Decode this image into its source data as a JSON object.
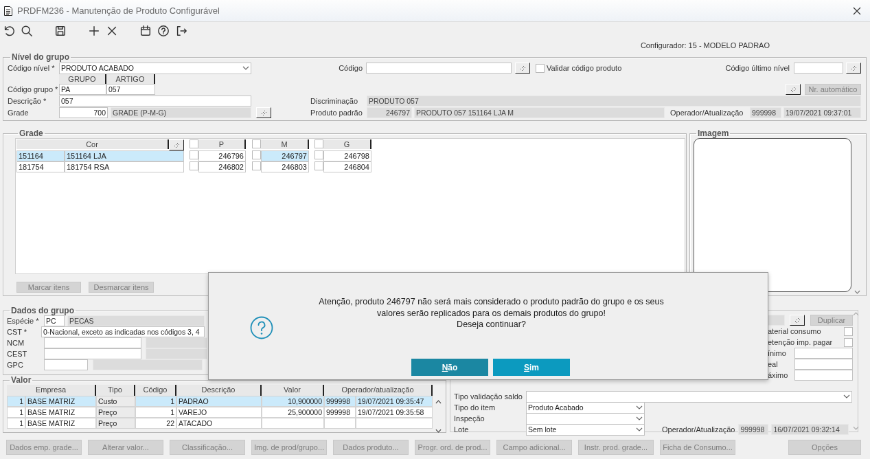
{
  "window": {
    "title": "PRDFM236 - Manutenção de Produto Configurável"
  },
  "configurator": "Configurador: 15 - MODELO PADRAO",
  "group_level": {
    "legend": "Nível do grupo",
    "codigo_nivel": {
      "label": "Código nível *",
      "value": "PRODUTO ACABADO"
    },
    "codigo": {
      "label": "Código"
    },
    "validar": {
      "label": "Validar código produto",
      "checked": false
    },
    "codigo_ultimo_nivel": {
      "label": "Código último nível"
    },
    "group_headers": [
      "GRUPO",
      "ARTIGO"
    ],
    "codigo_grupo": {
      "label": "Código grupo *",
      "values": [
        "PA",
        "057"
      ]
    },
    "nr_automatico": {
      "label": "Nr. automático",
      "disabled": true
    },
    "descricao": {
      "label": "Descrição *",
      "value": "057"
    },
    "discriminacao": {
      "label": "Discriminação",
      "value": "PRODUTO 057"
    },
    "grade": {
      "label": "Grade",
      "code": "700",
      "name": "GRADE (P-M-G)"
    },
    "produto_padrao": {
      "label": "Produto padrão",
      "code": "246797",
      "name": "PRODUTO 057 151164 LJA M"
    },
    "operador": {
      "label": "Operador/Atualização",
      "user": "999998",
      "date": "19/07/2021 09:37:01"
    }
  },
  "grade": {
    "legend": "Grade",
    "color_header": "Cor",
    "sizes": [
      {
        "label": "P",
        "checked": false
      },
      {
        "label": "M",
        "checked": false
      },
      {
        "label": "G",
        "checked": false
      }
    ],
    "rows": [
      {
        "code": "151164",
        "name": "151164 LJA",
        "selected": true,
        "cells": [
          {
            "value": "246796",
            "checked": false,
            "selected": false
          },
          {
            "value": "246797",
            "checked": false,
            "selected": true
          },
          {
            "value": "246798",
            "checked": false,
            "selected": false
          }
        ]
      },
      {
        "code": "181754",
        "name": "181754 RSA",
        "selected": false,
        "cells": [
          {
            "value": "246802",
            "checked": false,
            "selected": false
          },
          {
            "value": "246803",
            "checked": false,
            "selected": false
          },
          {
            "value": "246804",
            "checked": false,
            "selected": false
          }
        ]
      }
    ],
    "buttons": [
      {
        "label": "Marcar itens",
        "disabled": true
      },
      {
        "label": "Desmarcar itens",
        "disabled": true
      }
    ]
  },
  "image": {
    "legend": "Imagem"
  },
  "group_data": {
    "legend": "Dados do grupo",
    "especie": {
      "label": "Espécie *",
      "code": "PC",
      "name": "PECAS"
    },
    "cst": {
      "label": "CST *",
      "value": "0-Nacional, exceto as indicadas nos códigos 3, 4"
    },
    "ncm": {
      "label": "NCM"
    },
    "cest": {
      "label": "CEST"
    },
    "gpc": {
      "label": "GPC"
    }
  },
  "values": {
    "legend": "Valor",
    "columns": [
      "Empresa",
      "Tipo",
      "Código",
      "Descrição",
      "Valor",
      "Operador/atualização"
    ],
    "rows": [
      {
        "selected": true,
        "company_code": "1",
        "company": "BASE MATRIZ",
        "type": "Custo",
        "code": "1",
        "description": "PADRAO",
        "value": "10,900000",
        "user": "999998",
        "date": "19/07/2021 09:35:47"
      },
      {
        "selected": false,
        "company_code": "1",
        "company": "BASE MATRIZ",
        "type": "Preço",
        "code": "1",
        "description": "VAREJO",
        "value": "25,900000",
        "user": "999998",
        "date": "19/07/2021 09:35:58"
      },
      {
        "selected": false,
        "company_code": "1",
        "company": "BASE MATRIZ",
        "type": "Preço",
        "code": "22",
        "description": "ATACADO"
      }
    ]
  },
  "details": {
    "duplicar": {
      "label": "Duplicar",
      "disabled": true
    },
    "checks": [
      {
        "label": "aterial consumo",
        "checked": false
      },
      {
        "label": "etenção imp. pagar",
        "checked": false
      }
    ],
    "fields": [
      {
        "label": "ínimo"
      },
      {
        "label": "eal"
      },
      {
        "label": "áximo"
      }
    ],
    "tipo_validacao": {
      "label": "Tipo validação saldo"
    },
    "tipo_item": {
      "label": "Tipo do item",
      "value": "Produto Acabado"
    },
    "inspecao": {
      "label": "Inspeção"
    },
    "lote": {
      "label": "Lote",
      "value": "Sem lote"
    },
    "operador": {
      "label": "Operador/Atualização",
      "user": "999998",
      "date": "16/07/2021 09:32:14"
    }
  },
  "bottom_buttons": [
    {
      "label": "Dados emp. grade...",
      "disabled": true
    },
    {
      "label": "Alterar valor...",
      "disabled": true
    },
    {
      "label": "Classificação...",
      "disabled": true
    },
    {
      "label": "Img. de prod/grupo...",
      "disabled": true
    },
    {
      "label": "Dados produto...",
      "disabled": true
    },
    {
      "label": "Progr. ord. de prod...",
      "disabled": true
    },
    {
      "label": "Campo adicional...",
      "disabled": true
    },
    {
      "label": "Instr. prod. grade...",
      "disabled": true
    },
    {
      "label": "Ficha de Consumo...",
      "disabled": true
    },
    {
      "label": "Opções",
      "disabled": true
    }
  ],
  "dialog": {
    "message_lines": [
      "Atenção, produto 246797 não será mais considerado o produto padrão do grupo e os seus",
      "valores serão replicados para os demais produtos do grupo!",
      "Deseja continuar?"
    ],
    "buttons": [
      {
        "label": "Não",
        "selected": true
      },
      {
        "label": "Sim",
        "selected": false
      }
    ]
  }
}
